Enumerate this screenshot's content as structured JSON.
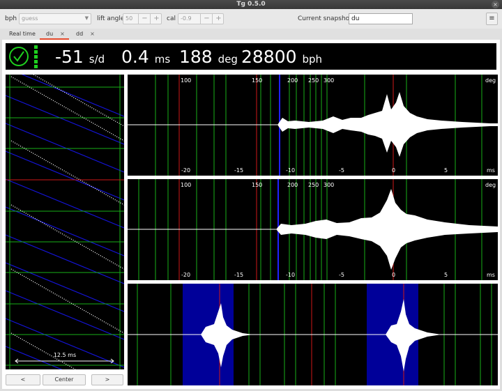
{
  "window": {
    "title": "Tg 0.5.0",
    "close_glyph": "×"
  },
  "toolbar": {
    "bph_label": "bph",
    "bph_value": "guess",
    "lift_label": "lift angle",
    "lift_value": "50",
    "cal_label": "cal",
    "cal_value": "-0.9",
    "minus": "−",
    "plus": "+",
    "snapshot_label": "Current snapshot:",
    "snapshot_value": "du",
    "menu_icon": "hamburger-icon"
  },
  "tabs": [
    {
      "label": "Real time",
      "closable": false,
      "active": false
    },
    {
      "label": "du",
      "closable": true,
      "active": true
    },
    {
      "label": "dd",
      "closable": true,
      "active": false
    }
  ],
  "status": {
    "rate": "-51",
    "rate_unit": "s/d",
    "beat_error": "0.4",
    "beat_error_unit": "ms",
    "amplitude": "188",
    "amplitude_unit": "deg",
    "bph": "28800",
    "bph_unit": "bph",
    "clock_icon": "clock-check-icon",
    "accent": "#1fd11f"
  },
  "paperstrip": {
    "span_label": "12.5 ms",
    "left_button": "<",
    "center_button": "Center",
    "right_button": ">"
  },
  "waveforms": {
    "deg_ticks": [
      "100",
      "150",
      "200",
      "250",
      "300"
    ],
    "deg_unit": "deg",
    "ms_ticks": [
      "-20",
      "-15",
      "-10",
      "-5",
      "0",
      "5"
    ],
    "ms_unit": "ms"
  },
  "colors": {
    "red": "#d01818",
    "green": "#18b018",
    "blue": "#1414d8",
    "highlight": "#000099"
  }
}
